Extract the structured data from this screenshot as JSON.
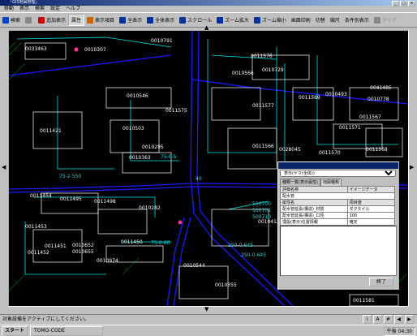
{
  "window": {
    "title": "「GIS地図管理」"
  },
  "menu": [
    "移動",
    "表示",
    "検索",
    "設定",
    "ヘルプ"
  ],
  "toolbar": {
    "items": [
      {
        "label": "検索",
        "icon": "search-icon",
        "color": "#0044cc",
        "active": false,
        "disabled": false
      },
      {
        "label": "",
        "icon": "back-icon",
        "color": "#888888",
        "active": false,
        "disabled": true
      },
      {
        "label": "追加表示",
        "icon": "add-display-icon",
        "color": "#cc0000",
        "active": false,
        "disabled": false
      },
      {
        "label": "属性",
        "icon": "",
        "color": "",
        "active": true,
        "disabled": false
      },
      {
        "label": "表示項目",
        "icon": "display-items-icon",
        "color": "#cc6600",
        "active": false,
        "disabled": false
      },
      {
        "label": "全表示",
        "icon": "show-all-icon",
        "color": "#003399",
        "active": false,
        "disabled": false
      },
      {
        "label": "全体表示",
        "icon": "full-view-icon",
        "color": "#003399",
        "active": false,
        "disabled": false
      },
      {
        "label": "スクロール",
        "icon": "scroll-icon",
        "color": "#003399",
        "active": false,
        "disabled": false
      },
      {
        "label": "ズーム拡大",
        "icon": "zoom-in-icon",
        "color": "#003399",
        "active": false,
        "disabled": false
      },
      {
        "label": "ズーム縮小",
        "icon": "zoom-out-icon",
        "color": "#003399",
        "active": false,
        "disabled": false
      },
      {
        "label": "画面印刷",
        "icon": "",
        "color": "",
        "active": false,
        "disabled": false
      },
      {
        "label": "切替",
        "icon": "",
        "color": "",
        "active": false,
        "disabled": false
      },
      {
        "label": "縮尺",
        "icon": "",
        "color": "",
        "active": false,
        "disabled": false
      },
      {
        "label": "条件別表示",
        "icon": "",
        "color": "",
        "active": false,
        "disabled": false
      },
      {
        "label": "クリア",
        "icon": "clear-icon",
        "color": "#888888",
        "active": false,
        "disabled": true
      }
    ]
  },
  "map": {
    "colors": {
      "road": "#1a1aff",
      "fence": "#00e6e6",
      "building": "#ffffff",
      "hatch": "#00cc00",
      "marker": "#ff3399"
    },
    "labels": [
      "0010791",
      "0033463",
      "0010307",
      "0011576",
      "0010566",
      "0010729",
      "0010493",
      "0041485",
      "0010546",
      "0011575",
      "0011577",
      "0011569",
      "0010778",
      "0011421",
      "0011567",
      "0010503",
      "0010295",
      "0011571",
      "0011566",
      "0028045",
      "0011570",
      "0011568",
      "0010363",
      "0011454",
      "0011495",
      "0011498",
      "0010282",
      "0011451",
      "0011452",
      "0011453",
      "0011450",
      "0010652",
      "0010655",
      "0010974",
      "0010544",
      "0010355",
      "0010413",
      "0011581"
    ],
    "road_labels": [
      "75-0-5",
      "75-2-550",
      "75-0-60",
      "250-0-645",
      "250-0-645"
    ],
    "numbers": [
      "40",
      "500700",
      "500701",
      "500710"
    ]
  },
  "panel": {
    "selector": "表示(ヤマ(全体))",
    "tabs": [
      "種類一覧(表示属性)",
      "地図種類"
    ],
    "table": {
      "headers": [
        "評価名称",
        "イメージデータ"
      ],
      "subheader": "配水管",
      "columns": [
        "属性名",
        "項目値"
      ],
      "rows": [
        [
          "配水管延長(構造)_材質",
          "ダクタイル"
        ],
        [
          "配水管延長(構造)_口径",
          "100"
        ],
        [
          "埋設(表示)位置情報",
          "確定"
        ]
      ]
    },
    "close": "終了"
  },
  "status": {
    "text": "対象設備をアクティブにしてください。"
  },
  "taskbar": {
    "start": "スタート",
    "app": "TOMO-CODE",
    "time": "午後 04:30"
  }
}
